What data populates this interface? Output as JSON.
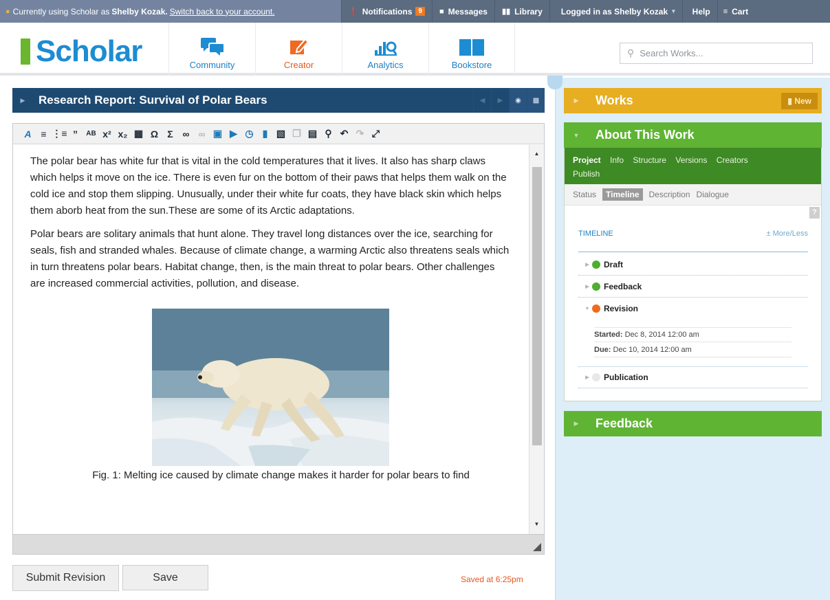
{
  "topbar": {
    "impersonation_prefix": "Currently using Scholar as",
    "impersonated_user": "Shelby Kozak.",
    "switch_back_link": "Switch back to your account.",
    "notifications_label": "Notifications",
    "notifications_count": "9",
    "messages_label": "Messages",
    "library_label": "Library",
    "logged_in_label": "Logged in as Shelby Kozak",
    "help_label": "Help",
    "cart_label": "Cart"
  },
  "header": {
    "logo_text": "Scholar",
    "tabs": [
      {
        "label": "Community",
        "icon": "chat-bubbles-icon"
      },
      {
        "label": "Creator",
        "icon": "pencil-edit-icon"
      },
      {
        "label": "Analytics",
        "icon": "bar-chart-magnifier-icon"
      },
      {
        "label": "Bookstore",
        "icon": "open-book-icon"
      }
    ],
    "active_tab": "Creator",
    "search_placeholder": "Search Works..."
  },
  "document": {
    "title": "Research Report: Survival of Polar Bears",
    "paragraphs": [
      "The polar bear has white fur that is vital in the cold temperatures that it lives. It also has sharp claws which helps it move on the ice. There is even fur on the bottom of their paws that helps them walk on the cold ice and stop them slipping. Unusually, under their white fur coats, they have black skin which helps them aborb heat from the sun.These are some of its Arctic adaptations.",
      "Polar bears are solitary animals that hunt alone. They travel long distances over the ice, searching for seals, fish and stranded whales. Because of climate change, a warming Arctic also threatens seals which in turn threatens polar bears. Habitat change, then, is the main threat to polar bears. Other challenges are increased commercial activities, pollution, and disease."
    ],
    "figure_caption": "Fig. 1: Melting ice caused by climate change makes it harder for polar bears to find"
  },
  "buttons": {
    "submit_revision": "Submit Revision",
    "save": "Save",
    "saved_status": "Saved at 6:25pm"
  },
  "sidebar": {
    "works_title": "Works",
    "works_new_button": "New",
    "about_title": "About This Work",
    "about_tabs": [
      "Project",
      "Info",
      "Structure",
      "Versions",
      "Creators",
      "Publish"
    ],
    "project_subtabs": [
      "Status",
      "Timeline",
      "Description",
      "Dialogue"
    ],
    "timeline_heading": "TIMELINE",
    "more_less": "± More/Less",
    "timeline": [
      {
        "label": "Draft",
        "status_color": "#4caf2e"
      },
      {
        "label": "Feedback",
        "status_color": "#4caf2e"
      },
      {
        "label": "Revision",
        "status_color": "#f06a1c"
      },
      {
        "label": "Publication",
        "status_color": "#e8e8e8"
      }
    ],
    "revision_started_label": "Started:",
    "revision_started_value": "Dec 8, 2014 12:00 am",
    "revision_due_label": "Due:",
    "revision_due_value": "Dec 10, 2014 12:00 am",
    "help_glyph": "?",
    "feedback_title": "Feedback"
  },
  "colors": {
    "brand_blue": "#1d8cd2",
    "brand_green": "#6ab62f",
    "accent_orange": "#e8561c",
    "works_yellow": "#e7ae22",
    "title_navy": "#1e4a72"
  }
}
